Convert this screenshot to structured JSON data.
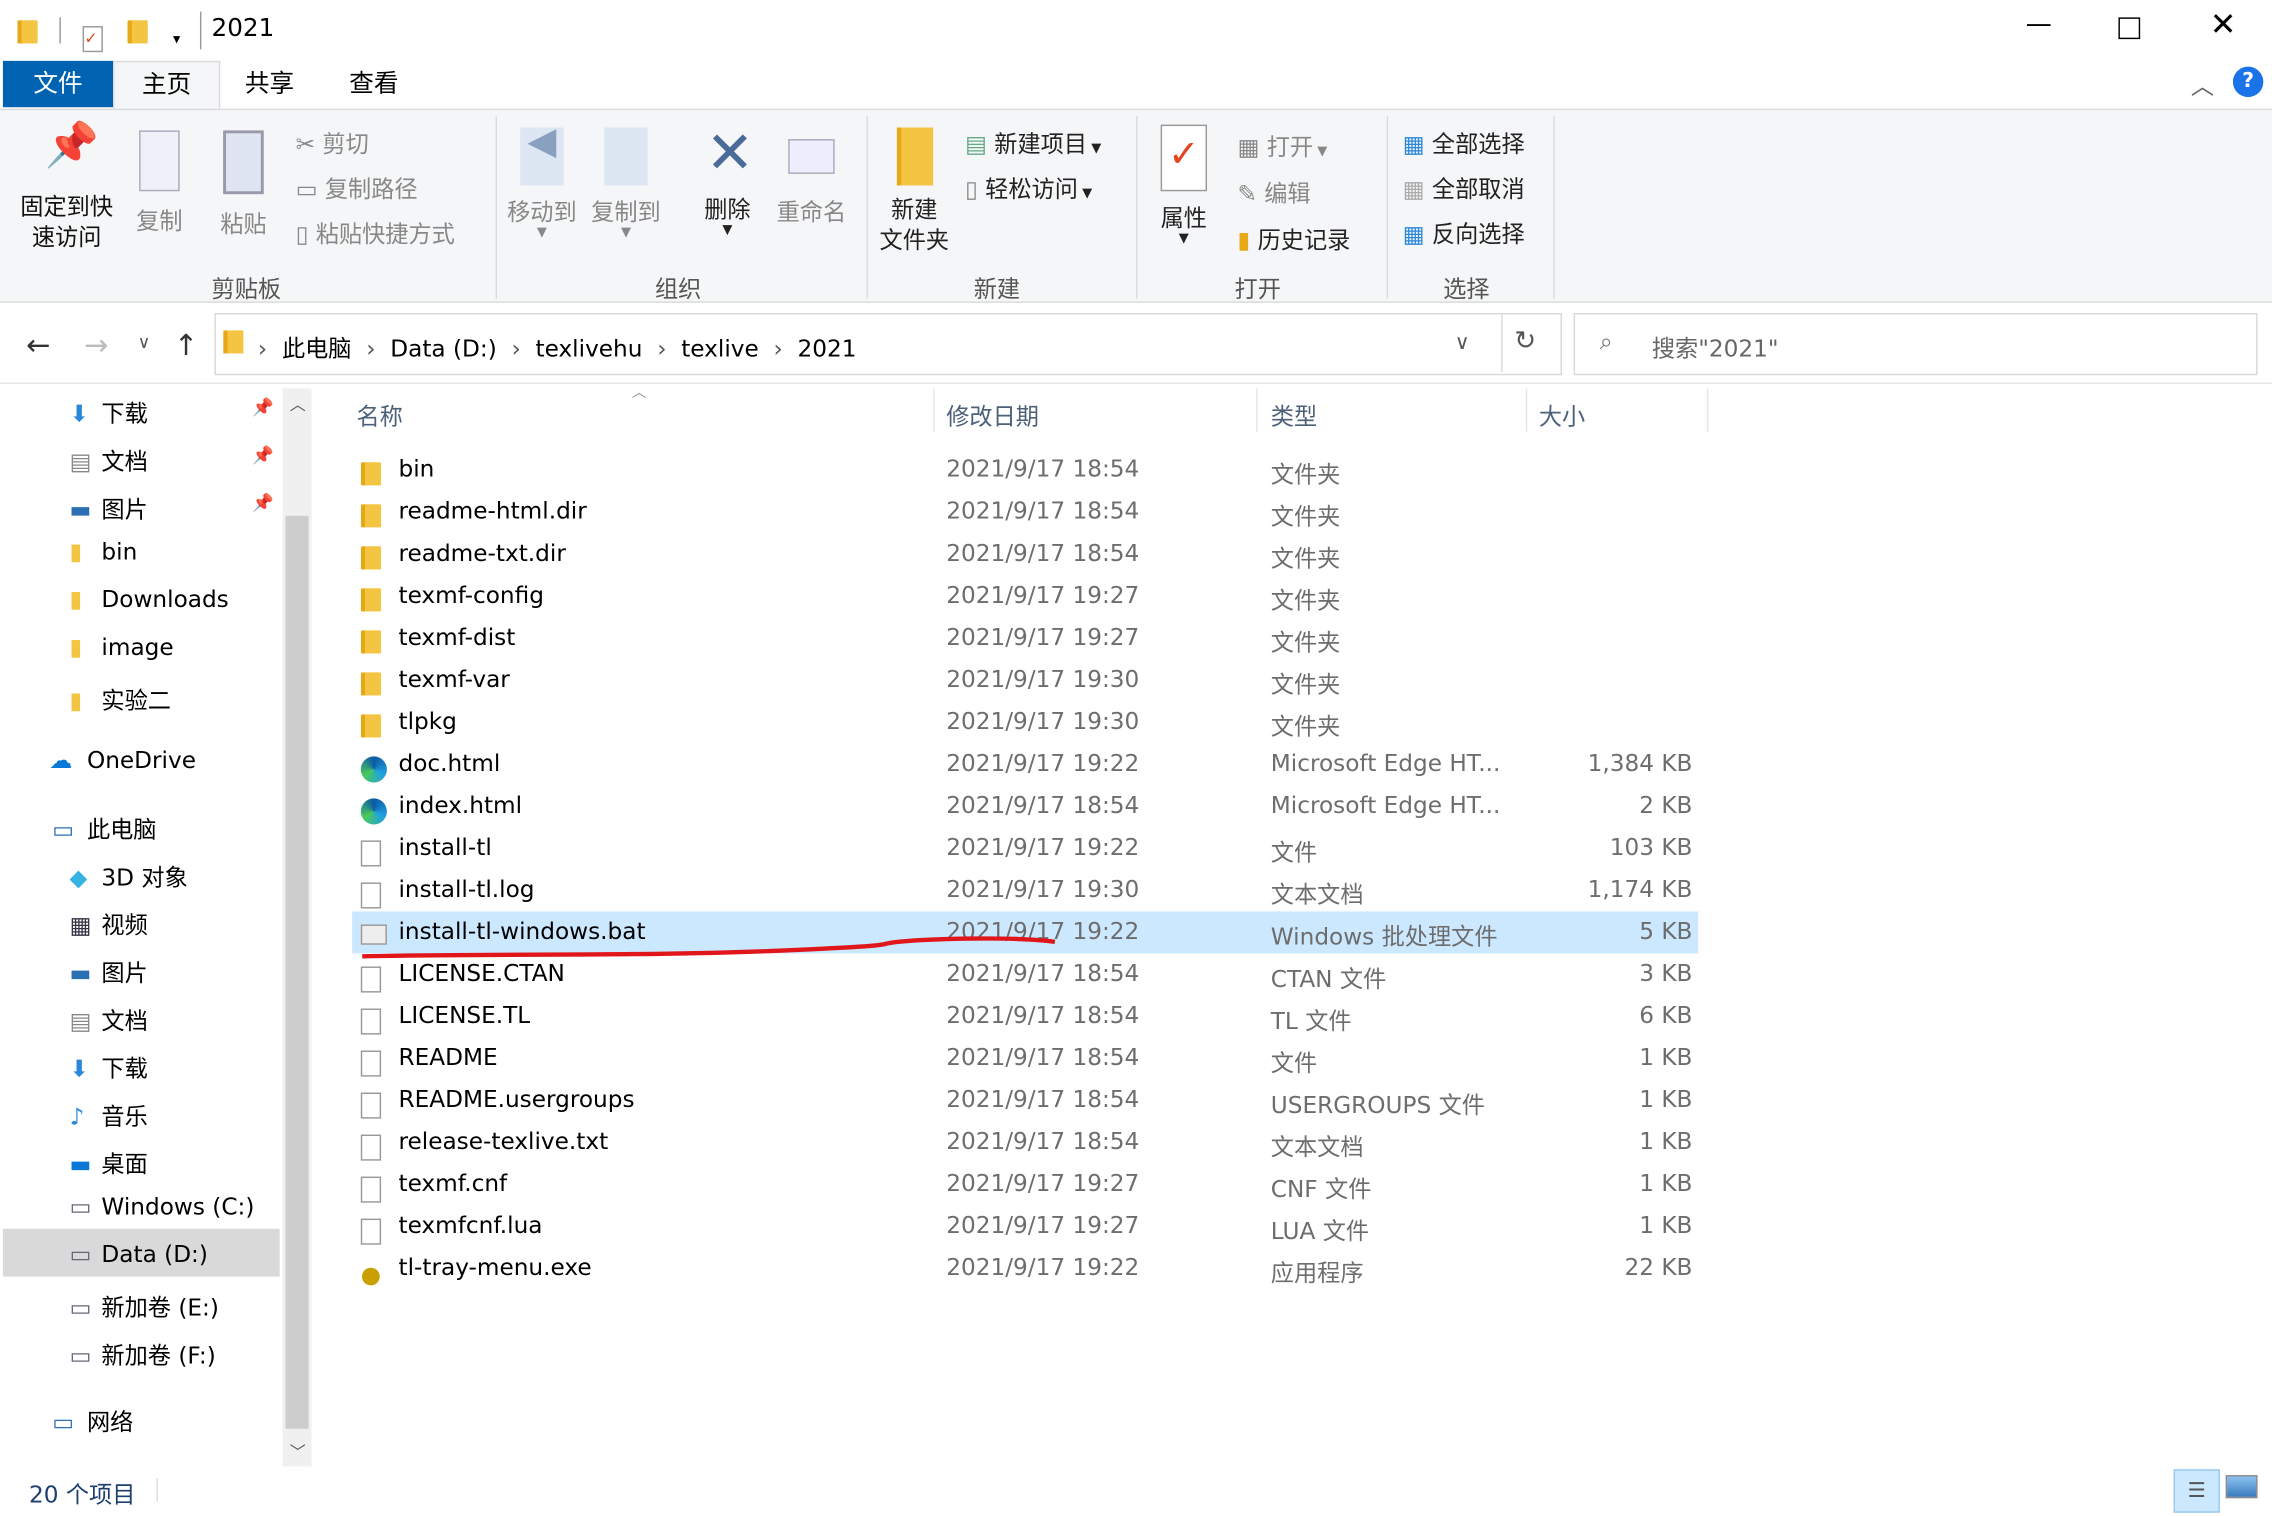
{
  "window": {
    "title": "2021",
    "controls": [
      "minimize",
      "maximize",
      "close"
    ]
  },
  "tabs": [
    {
      "label": "文件",
      "active": true
    },
    {
      "label": "主页"
    },
    {
      "label": "共享"
    },
    {
      "label": "查看"
    }
  ],
  "ribbon": {
    "clipboard": {
      "group": "剪贴板",
      "pin": "固定到快\n速访问",
      "copy": "复制",
      "paste": "粘贴",
      "cut": "剪切",
      "copy_path": "复制路径",
      "paste_shortcut": "粘贴快捷方式"
    },
    "organize": {
      "group": "组织",
      "move_to": "移动到",
      "copy_to": "复制到",
      "delete": "删除",
      "rename": "重命名"
    },
    "new": {
      "group": "新建",
      "new_folder": "新建\n文件夹",
      "new_item": "新建项目",
      "easy_access": "轻松访问"
    },
    "open": {
      "group": "打开",
      "properties": "属性",
      "open": "打开",
      "edit": "编辑",
      "history": "历史记录"
    },
    "select": {
      "group": "选择",
      "select_all": "全部选择",
      "select_none": "全部取消",
      "invert": "反向选择"
    }
  },
  "address": {
    "path": [
      "此电脑",
      "Data (D:)",
      "texlivehu",
      "texlive",
      "2021"
    ],
    "search_placeholder": "搜索\"2021\""
  },
  "sidebar": {
    "quick": [
      {
        "label": "下载",
        "icon": "download-icon",
        "pinned": true
      },
      {
        "label": "文档",
        "icon": "document-icon",
        "pinned": true
      },
      {
        "label": "图片",
        "icon": "pictures-icon",
        "pinned": true
      },
      {
        "label": "bin",
        "icon": "folder-icon"
      },
      {
        "label": "Downloads",
        "icon": "folder-icon"
      },
      {
        "label": "image",
        "icon": "folder-icon"
      },
      {
        "label": "实验二",
        "icon": "folder-icon"
      }
    ],
    "onedrive": "OneDrive",
    "pc": "此电脑",
    "pc_items": [
      {
        "label": "3D 对象",
        "icon": "3d-objects-icon"
      },
      {
        "label": "视频",
        "icon": "video-icon"
      },
      {
        "label": "图片",
        "icon": "pictures-icon"
      },
      {
        "label": "文档",
        "icon": "document-icon"
      },
      {
        "label": "下载",
        "icon": "download-icon"
      },
      {
        "label": "音乐",
        "icon": "music-icon"
      },
      {
        "label": "桌面",
        "icon": "desktop-icon"
      },
      {
        "label": "Windows (C:)",
        "icon": "drive-icon"
      },
      {
        "label": "Data (D:)",
        "icon": "drive-icon",
        "selected": true
      },
      {
        "label": "新加卷 (E:)",
        "icon": "drive-icon"
      },
      {
        "label": "新加卷 (F:)",
        "icon": "drive-icon"
      }
    ],
    "network": "网络"
  },
  "columns": {
    "name": "名称",
    "date": "修改日期",
    "type": "类型",
    "size": "大小"
  },
  "files": [
    {
      "name": "bin",
      "date": "2021/9/17 18:54",
      "type": "文件夹",
      "size": "",
      "icon": "folder"
    },
    {
      "name": "readme-html.dir",
      "date": "2021/9/17 18:54",
      "type": "文件夹",
      "size": "",
      "icon": "folder"
    },
    {
      "name": "readme-txt.dir",
      "date": "2021/9/17 18:54",
      "type": "文件夹",
      "size": "",
      "icon": "folder"
    },
    {
      "name": "texmf-config",
      "date": "2021/9/17 19:27",
      "type": "文件夹",
      "size": "",
      "icon": "folder"
    },
    {
      "name": "texmf-dist",
      "date": "2021/9/17 19:27",
      "type": "文件夹",
      "size": "",
      "icon": "folder"
    },
    {
      "name": "texmf-var",
      "date": "2021/9/17 19:30",
      "type": "文件夹",
      "size": "",
      "icon": "folder"
    },
    {
      "name": "tlpkg",
      "date": "2021/9/17 19:30",
      "type": "文件夹",
      "size": "",
      "icon": "folder"
    },
    {
      "name": "doc.html",
      "date": "2021/9/17 19:22",
      "type": "Microsoft Edge HT...",
      "size": "1,384 KB",
      "icon": "edge"
    },
    {
      "name": "index.html",
      "date": "2021/9/17 18:54",
      "type": "Microsoft Edge HT...",
      "size": "2 KB",
      "icon": "edge"
    },
    {
      "name": "install-tl",
      "date": "2021/9/17 19:22",
      "type": "文件",
      "size": "103 KB",
      "icon": "file"
    },
    {
      "name": "install-tl.log",
      "date": "2021/9/17 19:30",
      "type": "文本文档",
      "size": "1,174 KB",
      "icon": "file"
    },
    {
      "name": "install-tl-windows.bat",
      "date": "2021/9/17 19:22",
      "type": "Windows 批处理文件",
      "size": "5 KB",
      "icon": "bat",
      "selected": true
    },
    {
      "name": "LICENSE.CTAN",
      "date": "2021/9/17 18:54",
      "type": "CTAN 文件",
      "size": "3 KB",
      "icon": "file"
    },
    {
      "name": "LICENSE.TL",
      "date": "2021/9/17 18:54",
      "type": "TL 文件",
      "size": "6 KB",
      "icon": "file"
    },
    {
      "name": "README",
      "date": "2021/9/17 18:54",
      "type": "文件",
      "size": "1 KB",
      "icon": "file"
    },
    {
      "name": "README.usergroups",
      "date": "2021/9/17 18:54",
      "type": "USERGROUPS 文件",
      "size": "1 KB",
      "icon": "file"
    },
    {
      "name": "release-texlive.txt",
      "date": "2021/9/17 18:54",
      "type": "文本文档",
      "size": "1 KB",
      "icon": "file"
    },
    {
      "name": "texmf.cnf",
      "date": "2021/9/17 19:27",
      "type": "CNF 文件",
      "size": "1 KB",
      "icon": "file"
    },
    {
      "name": "texmfcnf.lua",
      "date": "2021/9/17 19:27",
      "type": "LUA 文件",
      "size": "1 KB",
      "icon": "file"
    },
    {
      "name": "tl-tray-menu.exe",
      "date": "2021/9/17 19:22",
      "type": "应用程序",
      "size": "22 KB",
      "icon": "exe"
    }
  ],
  "status": {
    "count": "20 个项目"
  },
  "colors": {
    "accent": "#0063b1",
    "selection": "#cce8ff",
    "annotation": "#e0161b"
  }
}
